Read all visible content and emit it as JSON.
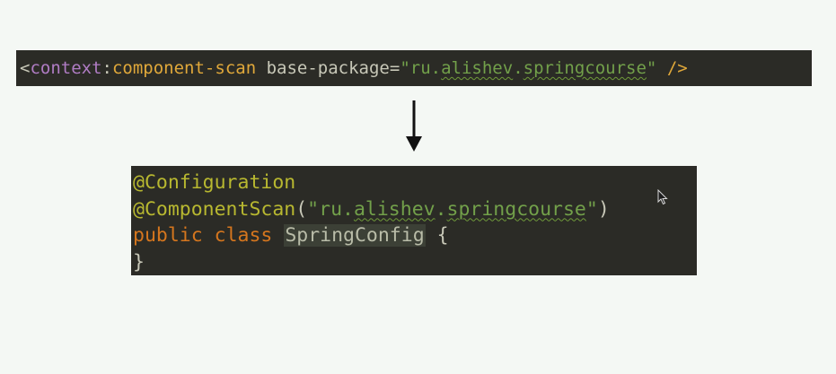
{
  "xml_snippet": {
    "open_bracket": "<",
    "namespace": "context",
    "colon": ":",
    "tag": "component-scan",
    "space": " ",
    "attr_name": "base-package",
    "equals": "=",
    "quote_open": "\"",
    "value_part1": "ru.",
    "value_part2": "alishev",
    "value_part3": ".",
    "value_part4": "springcourse",
    "quote_close": "\"",
    "close": " />"
  },
  "java_snippet": {
    "annotation_configuration": "@Configuration",
    "annotation_component_scan": "@ComponentScan",
    "paren_open": "(",
    "quote_open": "\"",
    "scan_part1": "ru.",
    "scan_part2": "alishev",
    "scan_part3": ".",
    "scan_part4": "springcourse",
    "quote_close": "\"",
    "paren_close": ")",
    "kw_public": "public",
    "kw_class": "class",
    "class_name": "SpringConfig",
    "brace_open": "{",
    "brace_close": "}"
  },
  "colors": {
    "background": "#f4f8f4",
    "code_background": "#2b2b26",
    "tag": "#e0a83a",
    "namespace": "#b07cc4",
    "string": "#72a04a",
    "annotation": "#b8b830",
    "keyword": "#d5761e"
  },
  "icons": {
    "arrow": "arrow-down-icon",
    "cursor": "mouse-pointer-icon"
  }
}
